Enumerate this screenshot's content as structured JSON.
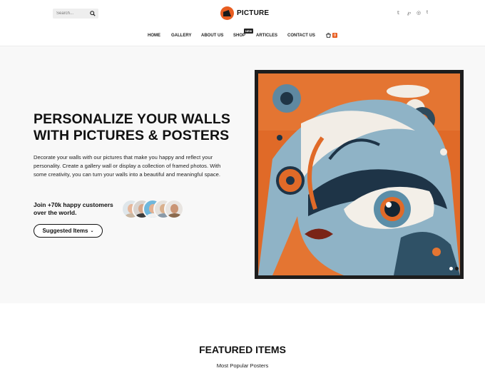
{
  "header": {
    "search_placeholder": "Search...",
    "logo_text": "PICTURE",
    "brand_color": "#e85d20",
    "social_icons": [
      "twitter-icon",
      "pinterest-icon",
      "instagram-icon",
      "tumblr-icon"
    ],
    "social_glyphs": [
      "𝕥",
      "℘",
      "◎",
      "t"
    ]
  },
  "nav": {
    "items": [
      "HOME",
      "GALLERY",
      "ABOUT US",
      "SHOP",
      "ARTICLES",
      "CONTACT US"
    ],
    "new_badge": "NEW",
    "cart_count": "0"
  },
  "hero": {
    "title_line1": "PERSONALIZE YOUR WALLS",
    "title_line2": "WITH PICTURES & POSTERS",
    "description": "Decorate your walls with our pictures that make you happy and reflect your personality. Create a gallery wall or display a collection of framed photos. With some creativity, you can turn your walls into a beautiful and meaningful space.",
    "join_text": "Join +70k happy customers over the world.",
    "button_label": "Suggested Items",
    "avatar_count": 5,
    "slider": {
      "slides": 2,
      "active": 1
    }
  },
  "featured": {
    "title": "FEATURED ITEMS",
    "subtitle": "Most Popular Posters"
  },
  "colors": {
    "accent": "#e85d20",
    "dark": "#111111",
    "hero_bg": "#f8f8f8"
  }
}
